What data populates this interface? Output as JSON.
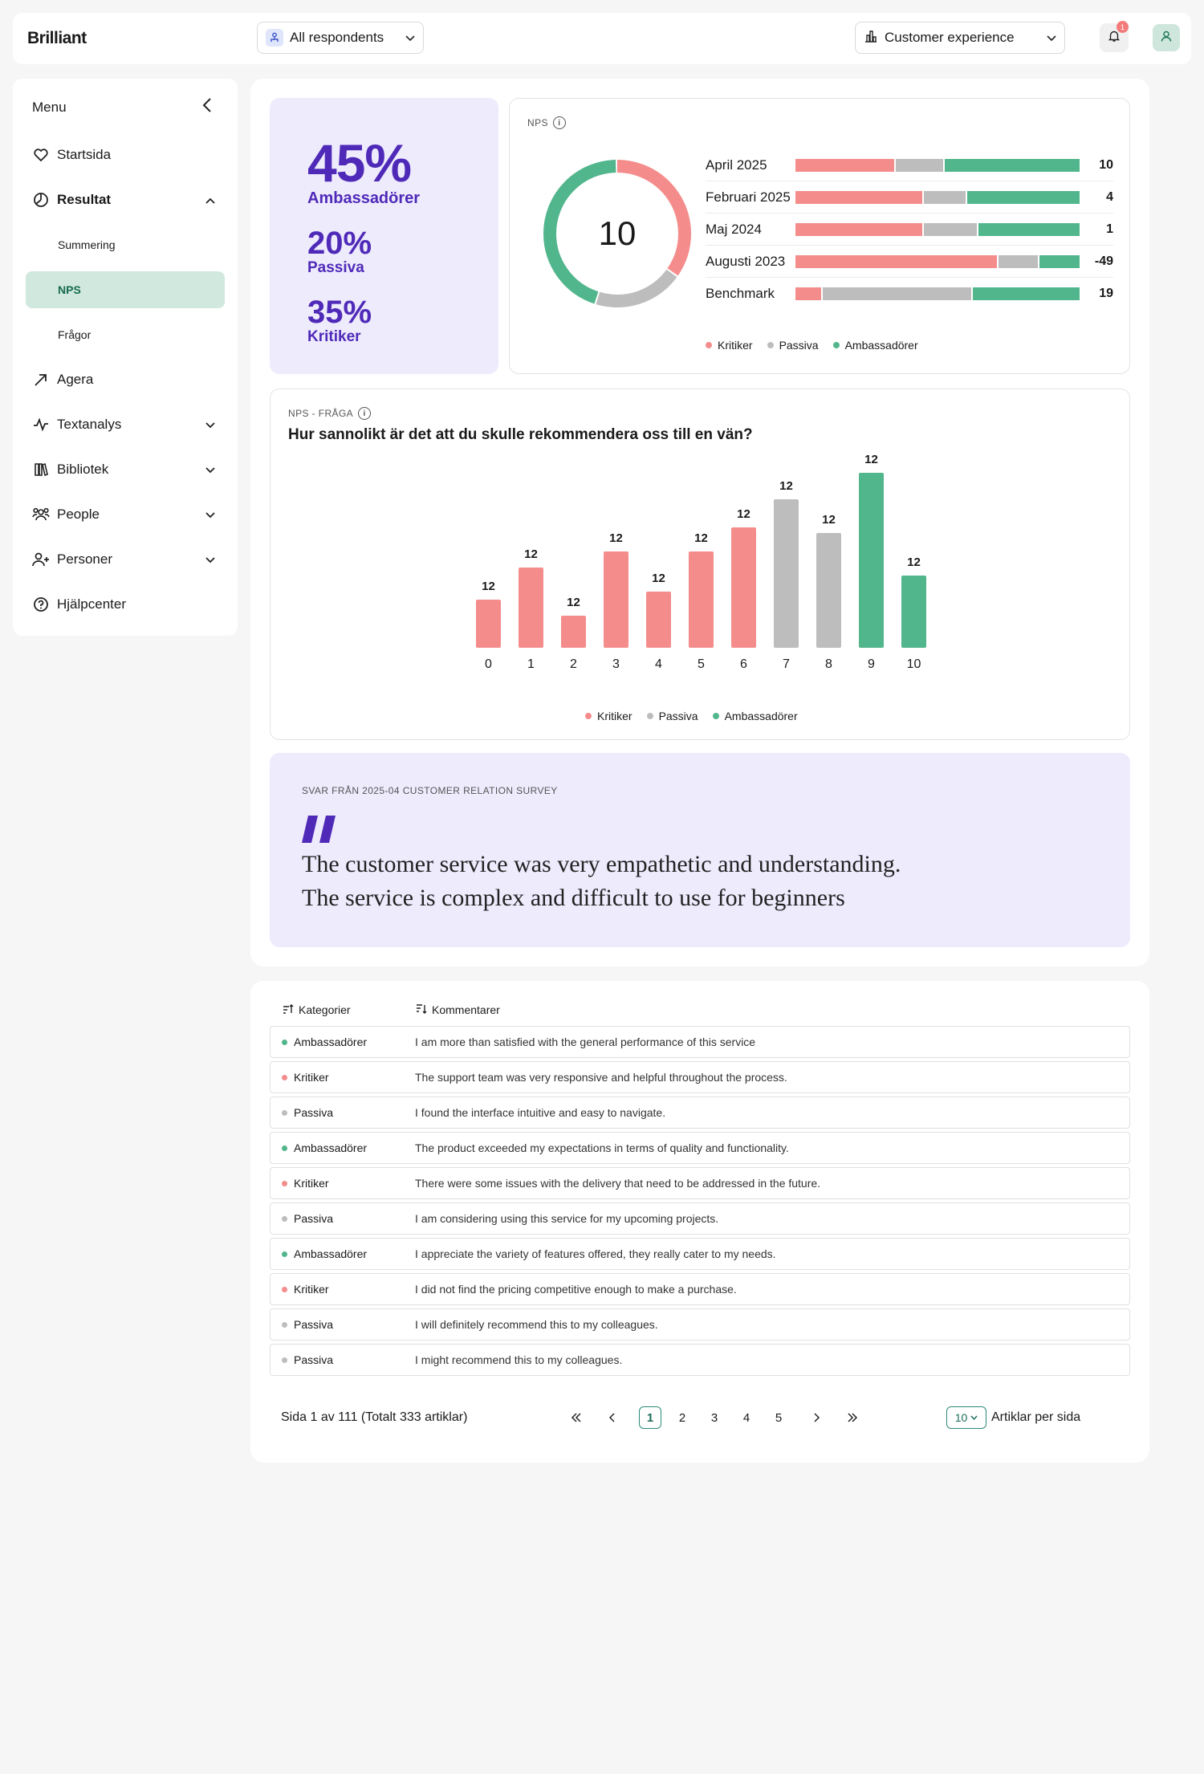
{
  "app": {
    "logo": "Brilliant"
  },
  "header": {
    "respondents_label": "All respondents",
    "area_label": "Customer experience",
    "notification_count": "1"
  },
  "sidebar": {
    "menu_label": "Menu",
    "items": [
      {
        "label": "Startsida",
        "icon": "heart-icon"
      },
      {
        "label": "Resultat",
        "icon": "pie-chart-icon"
      },
      {
        "label": "Agera",
        "icon": "arrow-up-right-icon"
      },
      {
        "label": "Textanalys",
        "icon": "activity-icon"
      },
      {
        "label": "Bibliotek",
        "icon": "library-icon"
      },
      {
        "label": "People",
        "icon": "people-icon"
      },
      {
        "label": "Personer",
        "icon": "person-icon"
      },
      {
        "label": "Hjälpcenter",
        "icon": "help-icon"
      }
    ],
    "sub_items": [
      "Summering",
      "NPS",
      "Frågor"
    ],
    "active_sub": "NPS"
  },
  "summary": {
    "ambassadors_pct": "45%",
    "ambassadors_label": "Ambassadörer",
    "passives_pct": "20%",
    "passives_label": "Passiva",
    "critics_pct": "35%",
    "critics_label": "Kritiker"
  },
  "nps": {
    "caption": "NPS",
    "score": "10",
    "donut": {
      "critics": 0.35,
      "passives": 0.2,
      "ambassadors": 0.45
    },
    "rows": [
      {
        "label": "April 2025",
        "critics": 35,
        "passives": 17,
        "ambassadors": 48,
        "value": "10"
      },
      {
        "label": "Februari 2025",
        "critics": 45,
        "passives": 15,
        "ambassadors": 40,
        "value": "4"
      },
      {
        "label": "Maj 2024",
        "critics": 45,
        "passives": 19,
        "ambassadors": 36,
        "value": "1"
      },
      {
        "label": "Augusti 2023",
        "critics": 81,
        "passives": 16,
        "ambassadors": 16,
        "value": "-49"
      },
      {
        "label": "Benchmark",
        "critics": 9,
        "passives": 53,
        "ambassadors": 38,
        "value": "19"
      }
    ]
  },
  "legend": {
    "critics": "Kritiker",
    "passives": "Passiva",
    "ambassadors": "Ambassadörer"
  },
  "colors": {
    "critics": "#f48c8c",
    "passives": "#bdbdbd",
    "ambassadors": "#52b68d",
    "accent": "#4f2ab8"
  },
  "question": {
    "caption": "NPS - FRÅGA",
    "title": "Hur sannolikt är det att du skulle rekommendera oss till en vän?"
  },
  "chart_data": {
    "type": "bar",
    "categories": [
      "0",
      "1",
      "2",
      "3",
      "4",
      "5",
      "6",
      "7",
      "8",
      "9",
      "10"
    ],
    "values": [
      12,
      12,
      12,
      12,
      12,
      12,
      12,
      12,
      12,
      12,
      12
    ],
    "heights": [
      60,
      100,
      40,
      120,
      70,
      120,
      150,
      185,
      143,
      218,
      90
    ],
    "groups": [
      "critics",
      "critics",
      "critics",
      "critics",
      "critics",
      "critics",
      "critics",
      "passives",
      "passives",
      "ambassadors",
      "ambassadors"
    ],
    "title": "Hur sannolikt är det att du skulle rekommendera oss till en vän?"
  },
  "quote": {
    "caption": "SVAR FRÅN 2025-04 CUSTOMER RELATION SURVEY",
    "line1": "The customer service was very empathetic and understanding.",
    "line2": "The service is complex and difficult to use for beginners"
  },
  "table": {
    "col_categories": "Kategorier",
    "col_comments": "Kommentarer",
    "rows": [
      {
        "category": "Ambassadörer",
        "group": "ambassadors",
        "comment": "I am more than satisfied with the general performance of this service"
      },
      {
        "category": "Kritiker",
        "group": "critics",
        "comment": "The support team was very responsive and helpful throughout the process."
      },
      {
        "category": "Passiva",
        "group": "passives",
        "comment": "I found the interface intuitive and easy to navigate."
      },
      {
        "category": "Ambassadörer",
        "group": "ambassadors",
        "comment": "The product exceeded my expectations in terms of quality and functionality."
      },
      {
        "category": "Kritiker",
        "group": "critics",
        "comment": "There were some issues with the delivery that need to be addressed in the future."
      },
      {
        "category": "Passiva",
        "group": "passives",
        "comment": "I am considering using this service for my upcoming projects."
      },
      {
        "category": "Ambassadörer",
        "group": "ambassadors",
        "comment": "I appreciate the variety of features offered, they really cater to my needs."
      },
      {
        "category": "Kritiker",
        "group": "critics",
        "comment": "I did not find the pricing competitive enough to make a purchase."
      },
      {
        "category": "Passiva",
        "group": "passives",
        "comment": "I will definitely recommend this to my colleagues."
      },
      {
        "category": "Passiva",
        "group": "passives",
        "comment": "I might recommend this to my colleagues."
      }
    ]
  },
  "pagination": {
    "info": "Sida 1 av 111 (Totalt 333 artiklar)",
    "pages": [
      "1",
      "2",
      "3",
      "4",
      "5"
    ],
    "current": "1",
    "per_page": "10",
    "per_page_label": "Artiklar per sida"
  }
}
